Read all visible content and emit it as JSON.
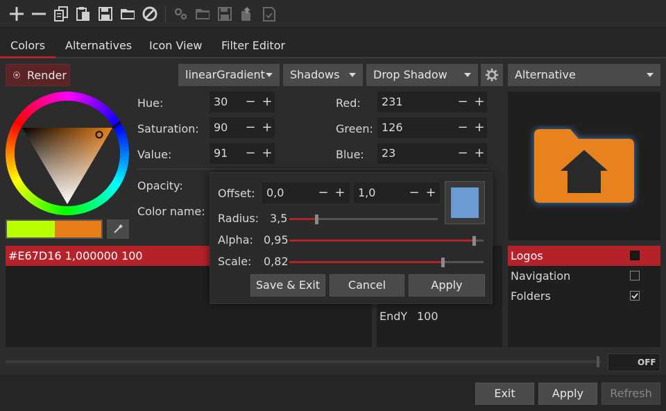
{
  "toolbar": {
    "icons": [
      "add-icon",
      "remove-icon",
      "copy-icon",
      "paste-icon",
      "save-icon",
      "folder-icon",
      "block-icon",
      "gear-icon",
      "folder-icon",
      "save-icon",
      "export-icon",
      "import-icon"
    ]
  },
  "tabs": [
    "Colors",
    "Alternatives",
    "Icon View",
    "Filter Editor"
  ],
  "render_button": "Render",
  "dropdowns": {
    "gradient": "linearGradient",
    "shadows": "Shadows",
    "effect": "Drop Shadow",
    "alternative": "Alternative"
  },
  "hsv": {
    "hue_label": "Hue:",
    "hue": "30",
    "sat_label": "Saturation:",
    "sat": "90",
    "val_label": "Value:",
    "val": "91"
  },
  "rgb": {
    "red_label": "Red:",
    "red": "231",
    "green_label": "Green:",
    "green": "126",
    "blue_label": "Blue:",
    "blue": "23"
  },
  "opacity_label": "Opacity:",
  "color_name_label": "Color name:",
  "color_list": [
    {
      "text": "#E67D16 1,000000 100",
      "selected": true
    }
  ],
  "gradient_list": {
    "endy_label": "EndY",
    "endy_value": "100"
  },
  "popup": {
    "offset_label": "Offset:",
    "offset_x": "0,0",
    "offset_y": "1,0",
    "radius_label": "Radius:",
    "radius_value": "3,5",
    "radius_fraction": 0.18,
    "alpha_label": "Alpha:",
    "alpha_value": "0,95",
    "alpha_fraction": 0.95,
    "scale_label": "Scale:",
    "scale_value": "0,82",
    "scale_fraction": 0.79,
    "swatch_color": "#6b9bd2",
    "save_exit": "Save & Exit",
    "cancel": "Cancel",
    "apply": "Apply"
  },
  "alternatives": [
    {
      "label": "Logos",
      "selected": true,
      "checked": "filled"
    },
    {
      "label": "Navigation",
      "selected": false,
      "checked": "empty"
    },
    {
      "label": "Folders",
      "selected": false,
      "checked": "check"
    }
  ],
  "toggle_label": "OFF",
  "bottom": {
    "exit": "Exit",
    "apply": "Apply",
    "refresh": "Refresh"
  },
  "colors": {
    "accent": "#b5222a",
    "current": "#E67D16",
    "previous": "#b8ff00",
    "icon_orange": "#e8821e",
    "glow": "#4a8fe0"
  }
}
